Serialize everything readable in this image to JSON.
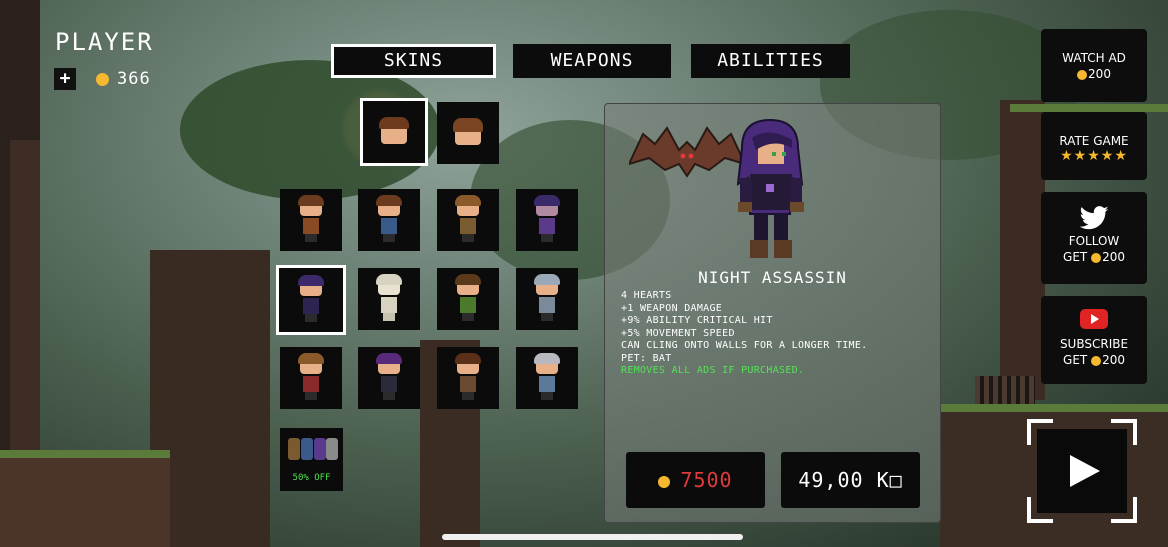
{
  "player": {
    "title": "PLAYER",
    "add_label": "+",
    "coins": "366"
  },
  "tabs": [
    {
      "label": "SKINS",
      "active": true
    },
    {
      "label": "WEAPONS",
      "active": false
    },
    {
      "label": "ABILITIES",
      "active": false
    }
  ],
  "bundle": {
    "label": "50% OFF"
  },
  "skin": {
    "name": "NIGHT ASSASSIN",
    "stats": [
      "4 HEARTS",
      "+1 WEAPON DAMAGE",
      "+9% ABILITY CRITICAL HIT",
      "+5% MOVEMENT SPEED",
      "CAN CLING ONTO WALLS FOR A LONGER TIME.",
      "PET: BAT"
    ],
    "ads_note": "REMOVES ALL ADS IF PURCHASED.",
    "coin_price": "7500",
    "money_price": "49,00 K□"
  },
  "side": {
    "watch_ad": {
      "label": "WATCH AD",
      "reward": "200"
    },
    "rate_game": {
      "label": "RATE GAME",
      "stars": "★★★★★"
    },
    "follow": {
      "label": "FOLLOW",
      "get": "GET",
      "reward": "200"
    },
    "subscribe": {
      "label": "SUBSCRIBE",
      "get": "GET",
      "reward": "200"
    }
  },
  "colors": {
    "coin": "#f5b82e",
    "price_red": "#e03a3a",
    "ads_green": "#55e355",
    "panel_dark": "#0b0b0b"
  },
  "icons": [
    "coin-icon",
    "plus-icon",
    "twitter-bird-icon",
    "youtube-play-icon",
    "play-icon",
    "star-icon"
  ]
}
